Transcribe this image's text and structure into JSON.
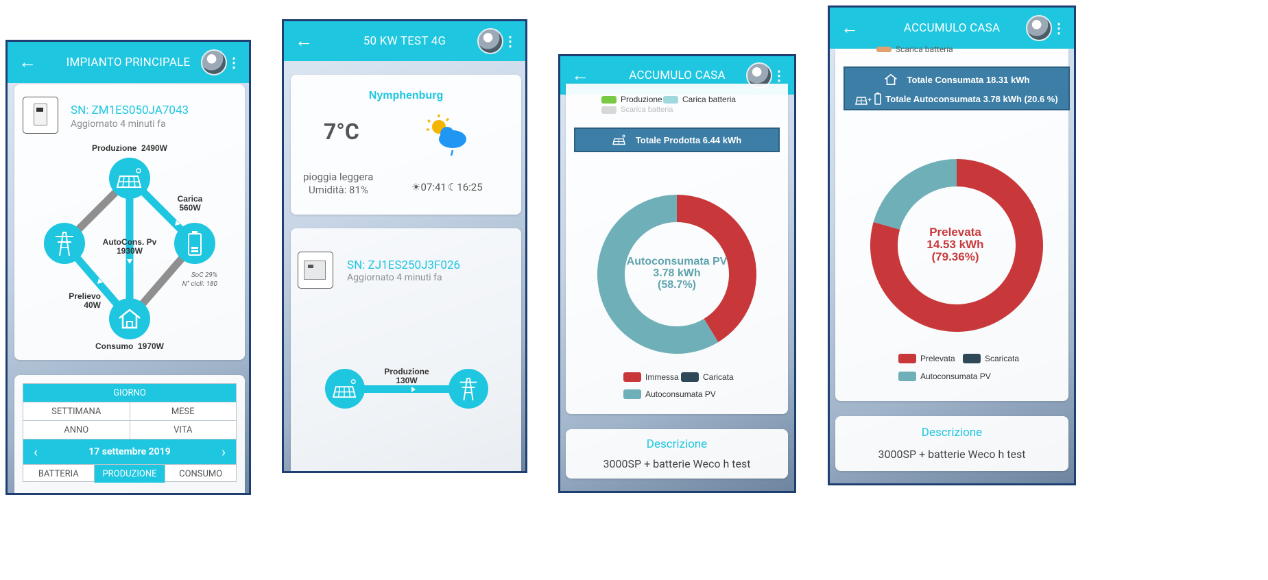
{
  "screen1": {
    "title": "IMPIANTO PRINCIPALE",
    "sn": "SN: ZM1ES050JA7043",
    "updated": "Aggiornato 4 minuti fa",
    "produzione": "Produzione  2490W",
    "carica": "Carica",
    "carica_val": "560W",
    "autocons": "AutoCons. Pv",
    "autocons_val": "1930W",
    "prelievo": "Prelievo",
    "prelievo_val": "40W",
    "soc": "SoC 29%",
    "cicli": "N° cicli: 180",
    "consumo": "Consumo  1970W",
    "tabs": {
      "giorno": "GIORNO",
      "settimana": "SETTIMANA",
      "mese": "MESE",
      "anno": "ANNO",
      "vita": "VITA",
      "date": "17 settembre 2019",
      "prev": "‹",
      "next": "›",
      "batteria": "BATTERIA",
      "produzione": "PRODUZIONE",
      "consumo": "CONSUMO"
    }
  },
  "screen2": {
    "title": "50 KW TEST 4G",
    "location": "Nymphenburg",
    "temp": "7°C",
    "condition": "pioggia leggera",
    "humidity": "Umidità: 81%",
    "sunrise": "07:41",
    "sunset": "16:25",
    "sn": "SN: ZJ1ES250J3F026",
    "updated": "Aggiornato 4 minuti fa",
    "produzione": "Produzione",
    "produzione_val": "130W"
  },
  "screen3": {
    "title": "ACCUMULO CASA",
    "legend_top": [
      "Produzione",
      "Carica batteria",
      "Scarica batteria"
    ],
    "totale": "Totale Prodotta 6.44 kWh",
    "center_line1": "Autoconsumata PV",
    "center_line2": "3.78 kWh",
    "center_line3": "(58.7%)",
    "legend": [
      "Immessa",
      "Caricata",
      "Autoconsumata PV"
    ],
    "desc_title": "Descrizione",
    "desc_text": "3000SP + batterie Weco h test"
  },
  "screen4": {
    "title": "ACCUMULO CASA",
    "legend_top_partial": "Scarica batteria",
    "totale_consumata": "Totale Consumata 18.31 kWh",
    "totale_autoconsumata": "Totale Autoconsumata 3.78 kWh (20.6 %)",
    "center_line1": "Prelevata",
    "center_line2": "14.53 kWh",
    "center_line3": "(79.36%)",
    "legend": [
      "Prelevata",
      "Scaricata",
      "Autoconsumata PV"
    ],
    "desc_title": "Descrizione",
    "desc_text": "3000SP + batterie Weco h test"
  },
  "colors": {
    "accent": "#1ec6e0",
    "red": "#c8383a",
    "teal_grey": "#6fb0b8",
    "navy": "#2f4858",
    "bar_blue": "#3d7ea6"
  },
  "chart_data": [
    {
      "type": "pie",
      "categories": [
        "Immessa",
        "Caricata",
        "Autoconsumata PV"
      ],
      "values": [
        41.3,
        0,
        58.7
      ],
      "title": "Totale Prodotta 6.44 kWh"
    },
    {
      "type": "pie",
      "categories": [
        "Prelevata",
        "Scaricata",
        "Autoconsumata PV"
      ],
      "values": [
        79.36,
        0,
        20.64
      ],
      "title": "Totale Consumata 18.31 kWh"
    }
  ]
}
